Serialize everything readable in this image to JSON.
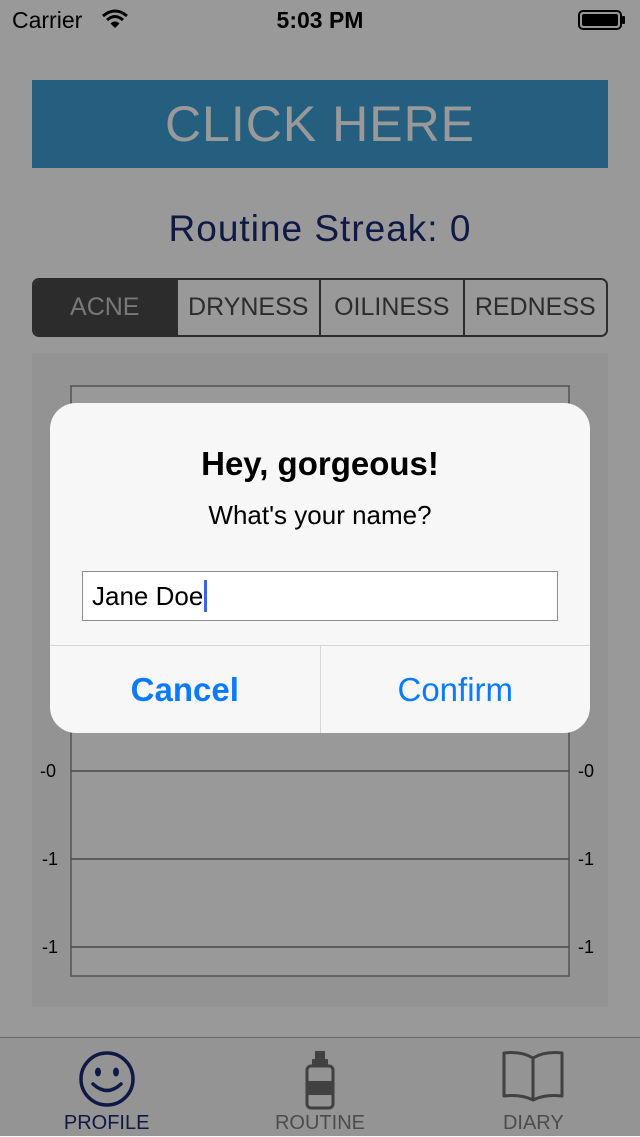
{
  "status_bar": {
    "carrier": "Carrier",
    "time": "5:03 PM"
  },
  "main": {
    "click_button_label": "CLICK HERE",
    "streak_text": "Routine Streak: 0",
    "segments": [
      {
        "label": "ACNE",
        "selected": true
      },
      {
        "label": "DRYNESS",
        "selected": false
      },
      {
        "label": "OILINESS",
        "selected": false
      },
      {
        "label": "REDNESS",
        "selected": false
      }
    ]
  },
  "chart": {
    "tick_labels_visible": [
      "-0",
      "-1",
      "-1"
    ]
  },
  "tab_bar": {
    "items": [
      {
        "label": "PROFILE",
        "icon": "smiley-face-icon",
        "active": true
      },
      {
        "label": "ROUTINE",
        "icon": "bottle-icon",
        "active": false
      },
      {
        "label": "DIARY",
        "icon": "open-book-icon",
        "active": false
      }
    ]
  },
  "alert": {
    "title": "Hey, gorgeous!",
    "message": "What's your name?",
    "input_value": "Jane Doe",
    "cancel_label": "Cancel",
    "confirm_label": "Confirm"
  },
  "colors": {
    "accent_blue": "#3d9fd6",
    "streak_navy": "#1c2b73",
    "alert_button_blue": "#0a7aff",
    "segment_dark": "#4a4a4a"
  }
}
